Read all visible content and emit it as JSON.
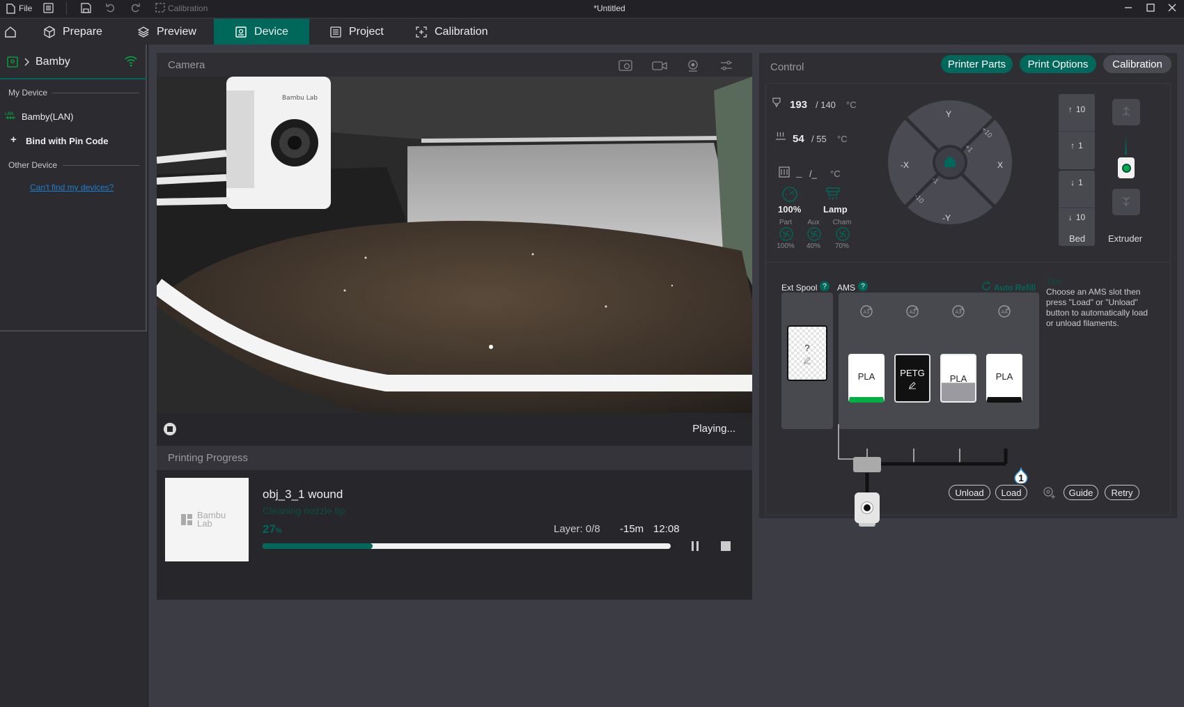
{
  "titlebar": {
    "file_label": "File",
    "calibration_label": "Calibration",
    "doc_title": "*Untitled"
  },
  "tabs": [
    {
      "label": "Prepare"
    },
    {
      "label": "Preview"
    },
    {
      "label": "Device"
    },
    {
      "label": "Project"
    },
    {
      "label": "Calibration"
    }
  ],
  "sidebar": {
    "printer_name": "Bamby",
    "my_device_heading": "My Device",
    "device_lan": "Bamby(LAN)",
    "bind_label": "Bind with Pin Code",
    "other_device_heading": "Other Device",
    "cant_find_link": "Can't find my devices?"
  },
  "camera": {
    "heading": "Camera",
    "status": "Playing..."
  },
  "progress": {
    "heading": "Printing Progress",
    "thumbnail_logo": "Bambu Lab",
    "job_name": "obj_3_1 wound",
    "stage": "Cleaning nozzle tip",
    "percent": "27",
    "percent_unit": "%",
    "percent_value": 0.27,
    "layer": "Layer: 0/8",
    "remaining": "-15m",
    "finish_time": "12:08"
  },
  "control": {
    "heading": "Control",
    "btn_printer_parts": "Printer Parts",
    "btn_print_options": "Print Options",
    "btn_calibration": "Calibration",
    "nozzle_temp": "193",
    "nozzle_target": "/ 140",
    "bed_temp": "54",
    "bed_target": "/ 55",
    "chamber_temp": "_",
    "chamber_target": "/_",
    "temp_unit": "°C",
    "speed_value": "100%",
    "lamp_label": "Lamp",
    "fans": [
      {
        "name": "Part",
        "value": "100%"
      },
      {
        "name": "Aux",
        "value": "40%"
      },
      {
        "name": "Cham",
        "value": "70%"
      }
    ],
    "jog": {
      "y_pos": "Y",
      "y_neg": "-Y",
      "x_pos": "X",
      "x_neg": "-X",
      "plus10": "+10",
      "plus1": "+1",
      "minus1": "-1",
      "minus10": "-10"
    },
    "bed_steps": [
      "10",
      "1",
      "1",
      "10"
    ],
    "bed_label": "Bed",
    "extruder_label": "Extruder"
  },
  "ams": {
    "ext_spool_label": "Ext Spool",
    "ams_label": "AMS",
    "auto_refill": "Auto Refill",
    "ext_slot_text": "?",
    "slots": [
      {
        "id": "A1",
        "material": "PLA",
        "color": "#ffffff"
      },
      {
        "id": "A2",
        "material": "PETG",
        "color": "#111111"
      },
      {
        "id": "A3",
        "material": "PLA",
        "color": "#ffffff"
      },
      {
        "id": "A4",
        "material": "PLA",
        "color": "#ffffff"
      }
    ],
    "active_badge": "1",
    "tips_title": "Tips",
    "tips_text": "Choose an AMS slot then press \"Load\" or \"Unload\" button to automatically load or unload filaments.",
    "btn_unload": "Unload",
    "btn_load": "Load",
    "btn_guide": "Guide",
    "btn_retry": "Retry"
  },
  "colors": {
    "accent": "#00675b",
    "accent_light": "#00ae42",
    "bg_dark": "#2b2b30"
  }
}
